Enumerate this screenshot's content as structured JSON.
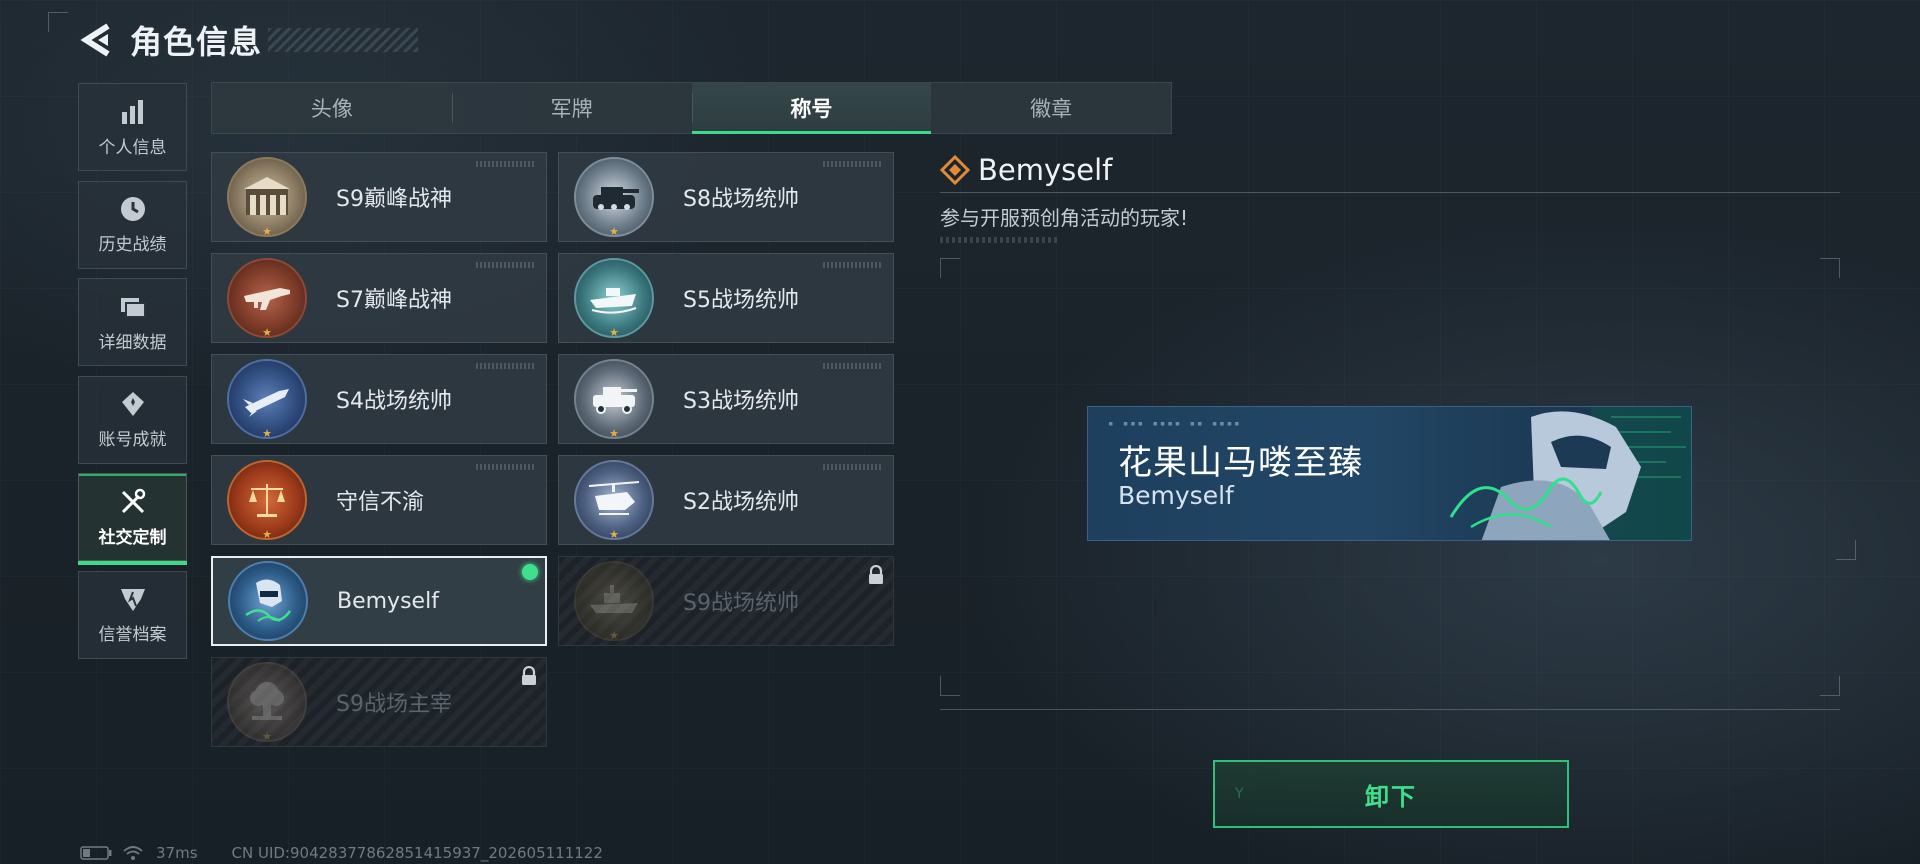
{
  "header": {
    "title": "角色信息"
  },
  "sidebar": {
    "items": [
      {
        "label": "个人信息",
        "icon": "bar-chart-icon",
        "active": false
      },
      {
        "label": "历史战绩",
        "icon": "clock-icon",
        "active": false
      },
      {
        "label": "详细数据",
        "icon": "folder-icon",
        "active": false
      },
      {
        "label": "账号成就",
        "icon": "achievement-badge-icon",
        "active": false
      },
      {
        "label": "社交定制",
        "icon": "tools-icon",
        "active": true
      },
      {
        "label": "信誉档案",
        "icon": "shield-emblem-icon",
        "active": false
      }
    ]
  },
  "tabs": [
    {
      "label": "头像",
      "active": false
    },
    {
      "label": "军牌",
      "active": false
    },
    {
      "label": "称号",
      "active": true
    },
    {
      "label": "徽章",
      "active": false
    }
  ],
  "titles": [
    {
      "name": "S9巅峰战神",
      "emblem": "fortress-emblem-icon",
      "state": "owned"
    },
    {
      "name": "S8战场统帅",
      "emblem": "tank-emblem-icon",
      "state": "owned"
    },
    {
      "name": "S7巅峰战神",
      "emblem": "rifle-emblem-icon",
      "state": "owned"
    },
    {
      "name": "S5战场统帅",
      "emblem": "boat-emblem-icon",
      "state": "owned"
    },
    {
      "name": "S4战场统帅",
      "emblem": "missile-emblem-icon",
      "state": "owned"
    },
    {
      "name": "S3战场统帅",
      "emblem": "vehicle-emblem-icon",
      "state": "owned"
    },
    {
      "name": "守信不渝",
      "emblem": "scales-emblem-icon",
      "state": "owned"
    },
    {
      "name": "S2战场统帅",
      "emblem": "helicopter-emblem-icon",
      "state": "owned"
    },
    {
      "name": "Bemyself",
      "emblem": "soldier-signature-emblem-icon",
      "state": "equipped"
    },
    {
      "name": "S9战场统帅",
      "emblem": "warship-emblem-icon",
      "state": "locked"
    },
    {
      "name": "S9战场主宰",
      "emblem": "explosion-emblem-icon",
      "state": "locked"
    }
  ],
  "detail": {
    "title": "Bemyself",
    "description": "参与开服预创角活动的玩家!",
    "banner": {
      "title": "花果山马喽至臻",
      "subtitle": "Bemyself"
    }
  },
  "actions": {
    "unequip_label": "卸下"
  },
  "status": {
    "ping": "37ms",
    "uid": "CN UID:90428377862851415937_202605111122"
  },
  "colors": {
    "accent": "#3fd98a",
    "background": "#1b232a",
    "banner": "#224766"
  }
}
